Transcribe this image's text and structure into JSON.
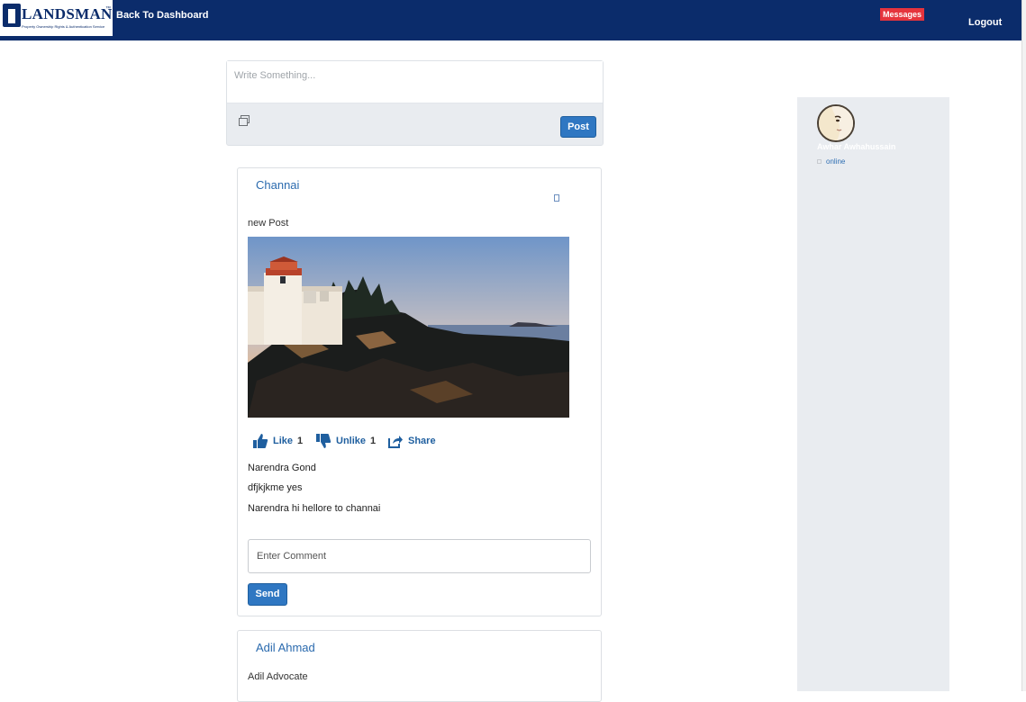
{
  "header": {
    "brand": "LANDSMAN",
    "brand_tm": "™",
    "tagline": "Property Ownership Rights & Authentication Service",
    "back_link": "Back To Dashboard",
    "messages_badge": "Messages",
    "logout": "Logout",
    "bg_color": "#0b2c6b"
  },
  "composer": {
    "placeholder": "Write Something...",
    "post_button": "Post",
    "attach_icon": "image-icon"
  },
  "posts": [
    {
      "author": "Channai",
      "text": "new Post",
      "image": "lighthouse-photo",
      "actions": {
        "like_label": "Like",
        "like_count": "1",
        "unlike_label": "Unlike",
        "unlike_count": "1",
        "share_label": "Share"
      },
      "comments": [
        "Narendra Gond",
        "dfjkjkme yes",
        "Narendra hi hellore to channai"
      ],
      "comment_placeholder": "Enter Comment",
      "send_button": "Send"
    },
    {
      "author": "Adil Ahmad",
      "text": "Adil Advocate"
    }
  ],
  "sidebar": {
    "user_name": "Awhar Awhahussain",
    "status": "online"
  },
  "colors": {
    "accent": "#2f77c2",
    "badge": "#e5343d",
    "panel": "#e9ecf0"
  }
}
